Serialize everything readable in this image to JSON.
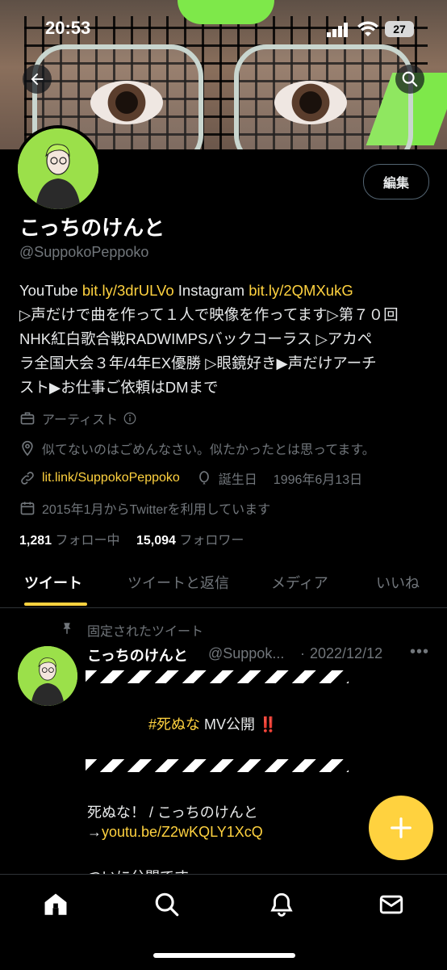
{
  "status_bar": {
    "time": "20:53",
    "battery": "27"
  },
  "profile": {
    "display_name": "こっちのけんと",
    "handle": "@SuppokoPeppoko",
    "edit_label": "編集",
    "bio": {
      "line1_prefix": "YouTube ",
      "line1_link1": "bit.ly/3drULVo",
      "line1_mid": " Instagram ",
      "line1_link2": "bit.ly/2QMXukG",
      "line2": "▷声だけで曲を作って１人で映像を作ってます▷第７０回",
      "line3": "NHK紅白歌合戦RADWIMPSバックコーラス ▷アカペ",
      "line4": "ラ全国大会３年/4年EX優勝 ▷眼鏡好き▶声だけアーチ",
      "line5": "スト▶お仕事ご依頼はDMまで"
    },
    "category": "アーティスト",
    "location": "似てないのはごめんなさい。似たかったとは思ってます。",
    "website": "lit.link/SuppokoPeppoko",
    "birthday_label": "誕生日",
    "birthday": "1996年6月13日",
    "joined": "2015年1月からTwitterを利用しています",
    "following_count": "1,281",
    "following_label": "フォロー中",
    "followers_count": "15,094",
    "followers_label": "フォロワー"
  },
  "tabs": [
    {
      "label": "ツイート"
    },
    {
      "label": "ツイートと返信"
    },
    {
      "label": "メディア"
    },
    {
      "label": "いいね"
    }
  ],
  "pinned_tweet": {
    "pinned_label": "固定されたツイート",
    "name": "こっちのけんと",
    "handle": "@Suppok...",
    "dot": "·",
    "date": "2022/12/12",
    "more": "•••",
    "hashtag": "#死ぬな",
    "headline_rest": " MV公開",
    "exclaim": "‼️",
    "song_line": "死ぬな！ / こっちのけんと",
    "arrow": "→",
    "video_link": "youtu.be/Z2wKQLY1XcQ",
    "partial_line": "ついに公開です"
  },
  "colors": {
    "accent": "#ffd23f",
    "muted": "#71767b",
    "background": "#000000"
  },
  "icons": [
    "back-arrow-icon",
    "search-icon",
    "briefcase-icon",
    "info-icon",
    "location-pin-icon",
    "link-icon",
    "balloon-icon",
    "calendar-icon",
    "pin-icon",
    "plus-icon",
    "home-icon",
    "bell-icon",
    "mail-icon"
  ]
}
